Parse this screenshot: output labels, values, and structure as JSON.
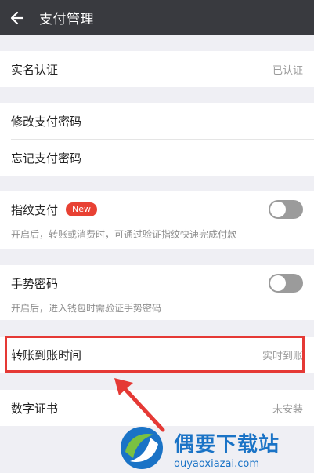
{
  "header": {
    "title": "支付管理",
    "back_icon": "arrow-left-icon"
  },
  "realname": {
    "label": "实名认证",
    "value": "已认证"
  },
  "password": {
    "change_label": "修改支付密码",
    "forgot_label": "忘记支付密码"
  },
  "fingerprint": {
    "label": "指纹支付",
    "badge": "New",
    "desc": "开启后，转账或消费时，可通过验证指纹快速完成付款",
    "enabled": false
  },
  "gesture": {
    "label": "手势密码",
    "desc": "开启后，进入钱包时需验证手势密码",
    "enabled": false
  },
  "transfer": {
    "label": "转账到账时间",
    "value": "实时到账"
  },
  "certificate": {
    "label": "数字证书",
    "value": "未安装"
  },
  "watermark": {
    "title": "偶要下载站",
    "url": "ouyaoxiazai.com"
  },
  "colors": {
    "header": "#393a3f",
    "highlight": "#e53935",
    "badge": "#e84133",
    "brand": "#1a73c6"
  }
}
